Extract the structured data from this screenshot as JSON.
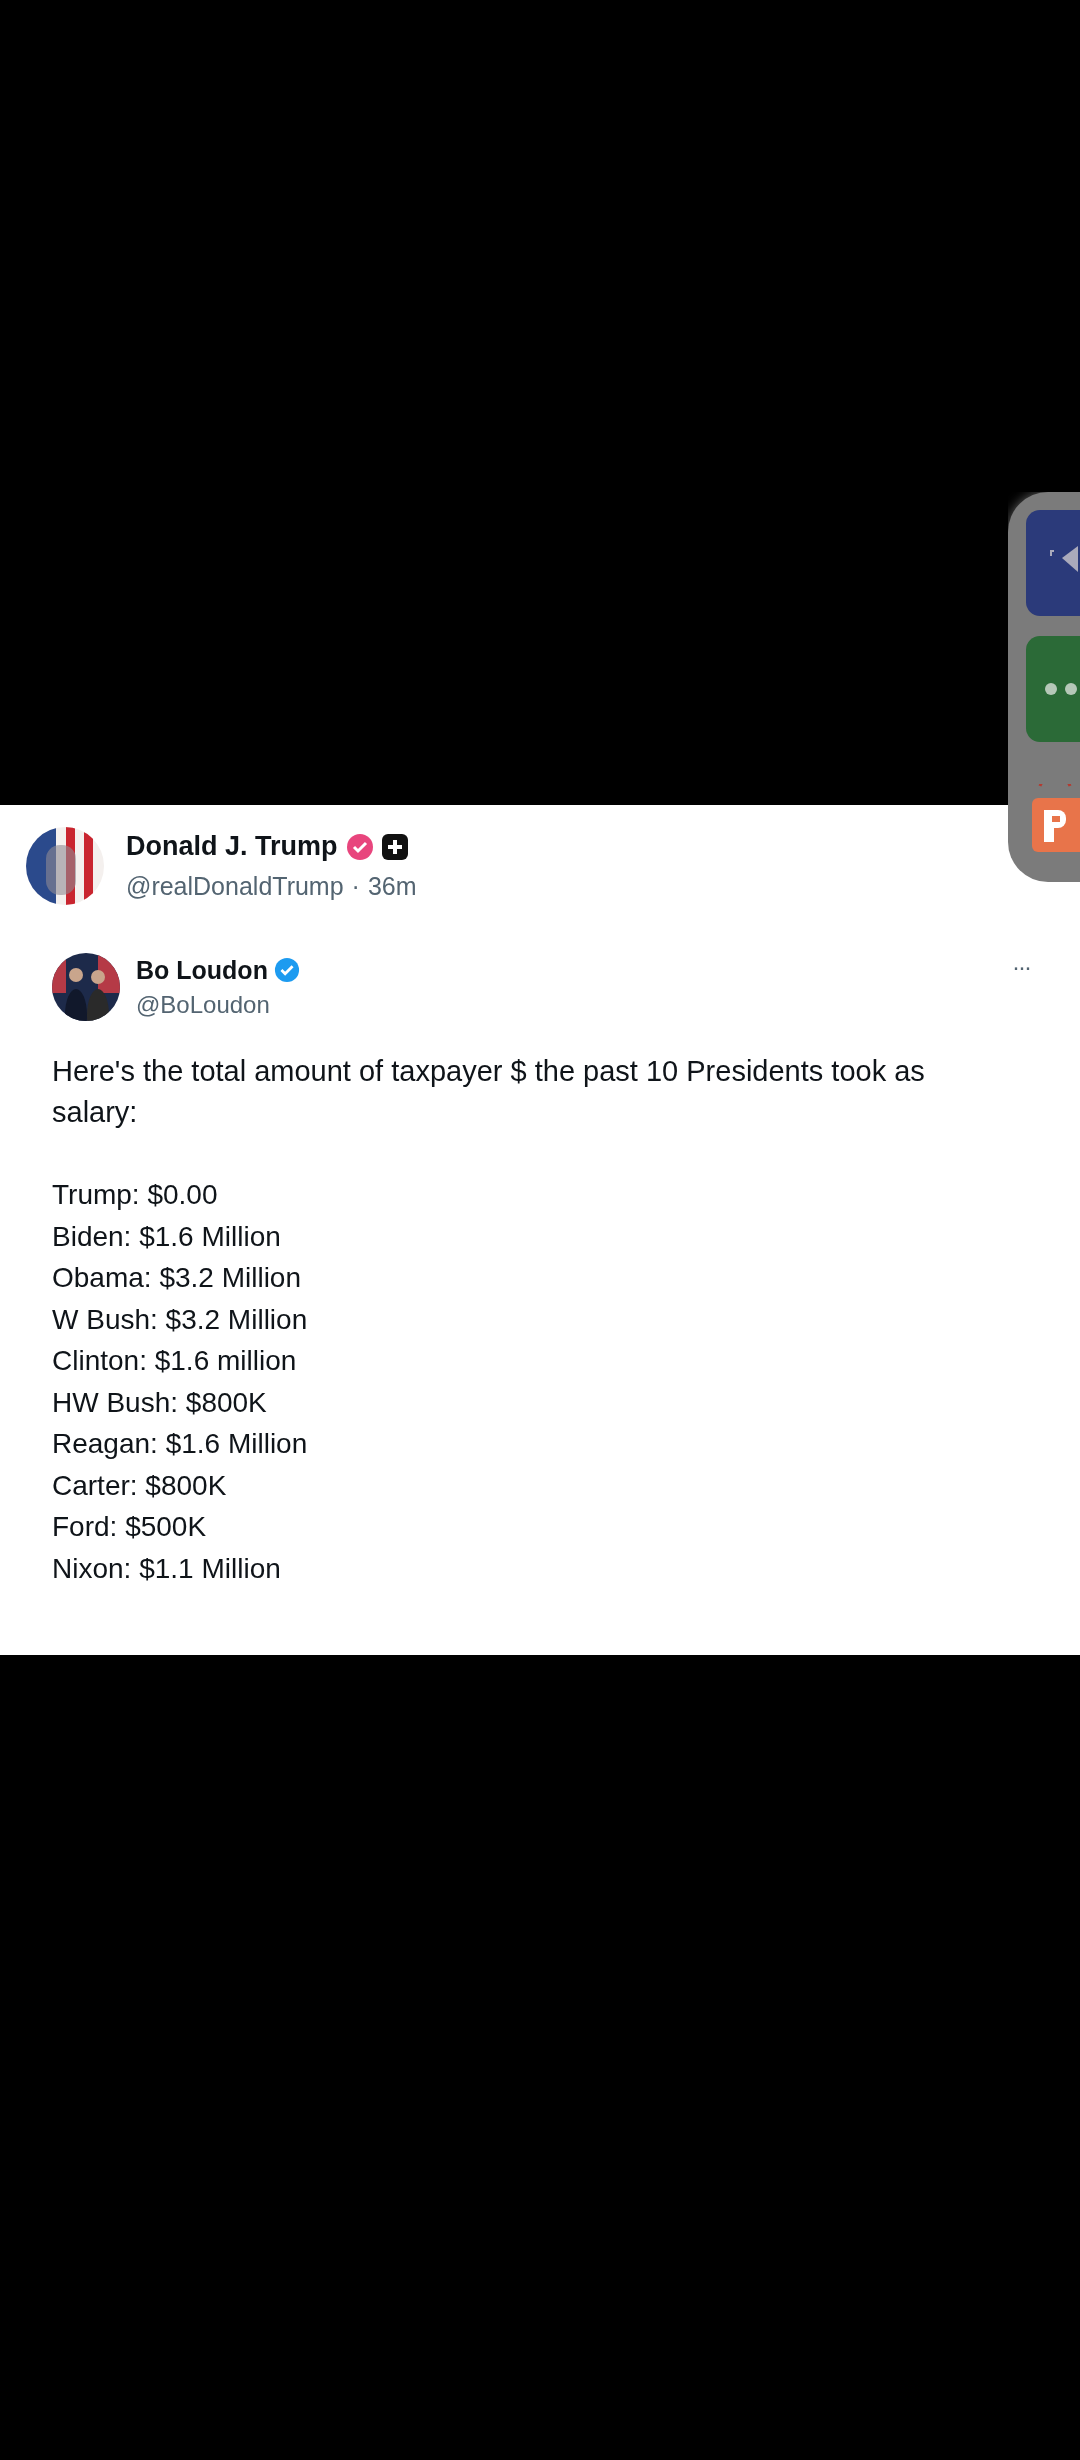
{
  "post": {
    "author": {
      "name": "Donald J. Trump",
      "handle": "@realDonaldTrump",
      "separator": "·",
      "time": "36m"
    },
    "quoted": {
      "author": {
        "name": "Bo Loudon",
        "handle": "@BoLoudon"
      },
      "more": "···",
      "text": "Here's the total amount of taxpayer $ the past 10 Presidents took as salary:",
      "lines": [
        "Trump: $0.00",
        "Biden: $1.6 Million",
        "Obama: $3.2 Million",
        "W Bush: $3.2 Million",
        "Clinton: $1.6 million",
        "HW Bush: $800K",
        "Reagan: $1.6 Million",
        "Carter: $800K",
        "Ford: $500K",
        "Nixon: $1.1 Million"
      ]
    }
  },
  "side_panel": {
    "apps": [
      {
        "kind": "blue"
      },
      {
        "kind": "green"
      },
      {
        "kind": "orange"
      }
    ]
  }
}
